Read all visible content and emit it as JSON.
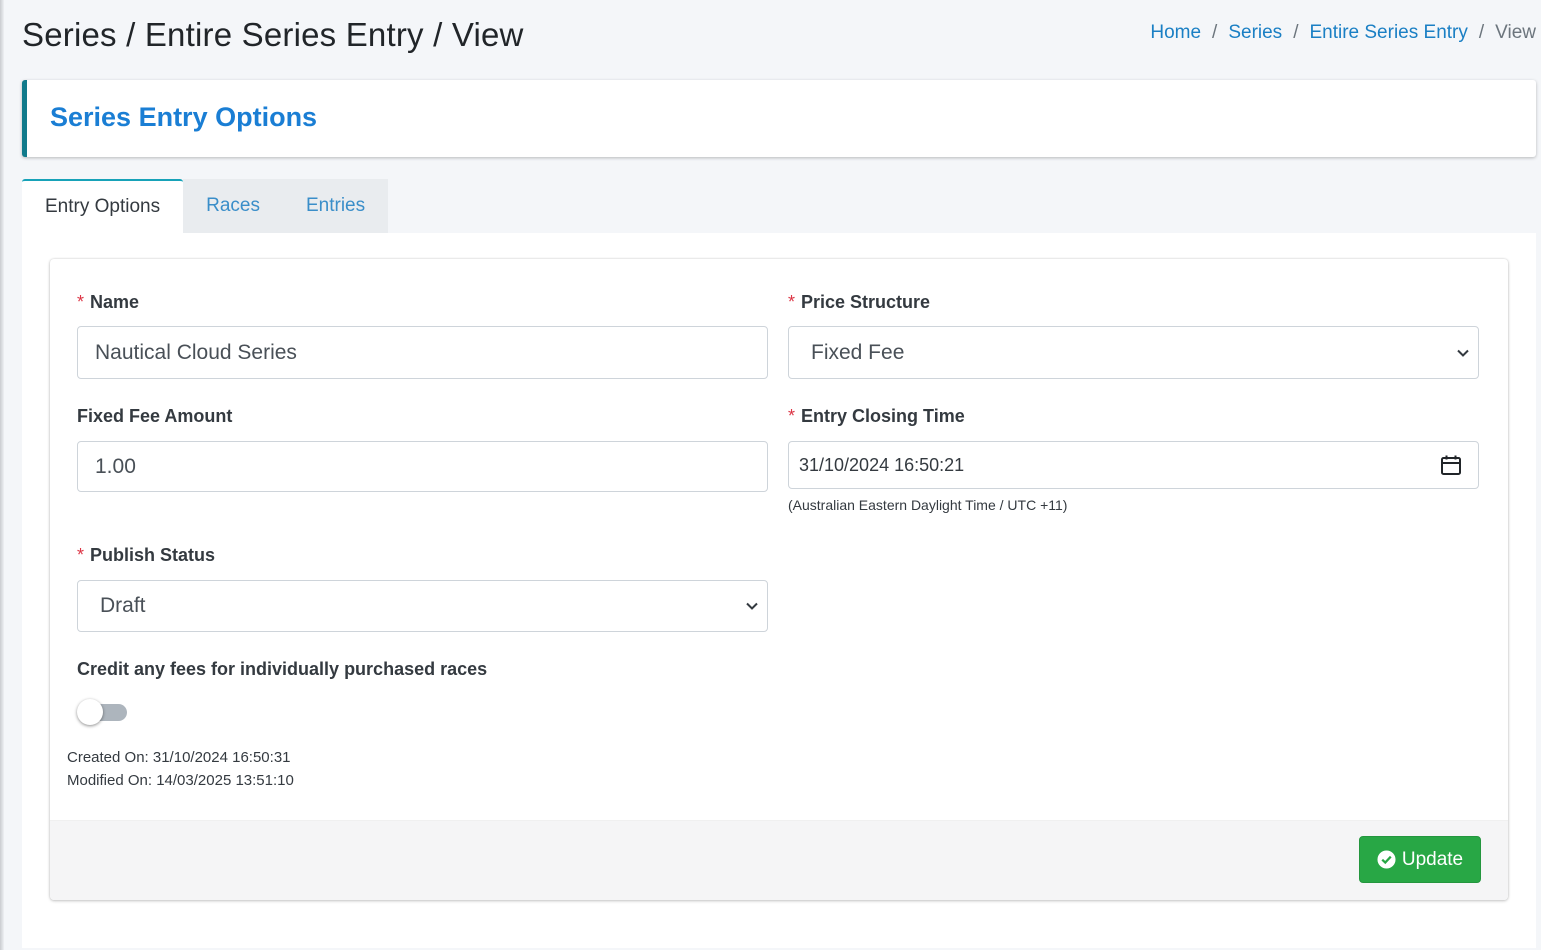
{
  "header": {
    "title": "Series / Entire Series Entry / View",
    "breadcrumb": [
      {
        "label": "Home"
      },
      {
        "label": "Series"
      },
      {
        "label": "Entire Series Entry"
      },
      {
        "label": "View"
      }
    ],
    "separator": "/"
  },
  "callout": {
    "title": "Series Entry Options"
  },
  "tabs": [
    {
      "label": "Entry Options",
      "active": true
    },
    {
      "label": "Races",
      "active": false
    },
    {
      "label": "Entries",
      "active": false
    }
  ],
  "form": {
    "required_marker": "*",
    "name": {
      "label": "Name",
      "value": "Nautical Cloud Series",
      "required": true
    },
    "price_structure": {
      "label": "Price Structure",
      "value": "Fixed Fee",
      "required": true
    },
    "fixed_fee_amount": {
      "label": "Fixed Fee Amount",
      "value": "1.00",
      "required": false
    },
    "entry_closing_time": {
      "label": "Entry Closing Time",
      "value": "31/10/2024 16:50:21",
      "note": "(Australian Eastern Daylight Time / UTC +11)",
      "required": true,
      "icon": "calendar-icon"
    },
    "publish_status": {
      "label": "Publish Status",
      "value": "Draft",
      "required": true
    },
    "credit_fees": {
      "label": "Credit any fees for individually purchased races",
      "enabled": false
    },
    "created_on": "Created On: 31/10/2024 16:50:31",
    "modified_on": "Modified On: 14/03/2025 13:51:10"
  },
  "footer": {
    "update_label": "Update",
    "update_icon": "check-circle-icon"
  },
  "colors": {
    "link": "#1a7fc4",
    "callout_title": "#1a7ed4",
    "callout_border": "#117a8b",
    "required": "#dc3545",
    "update_button": "#28a745"
  }
}
